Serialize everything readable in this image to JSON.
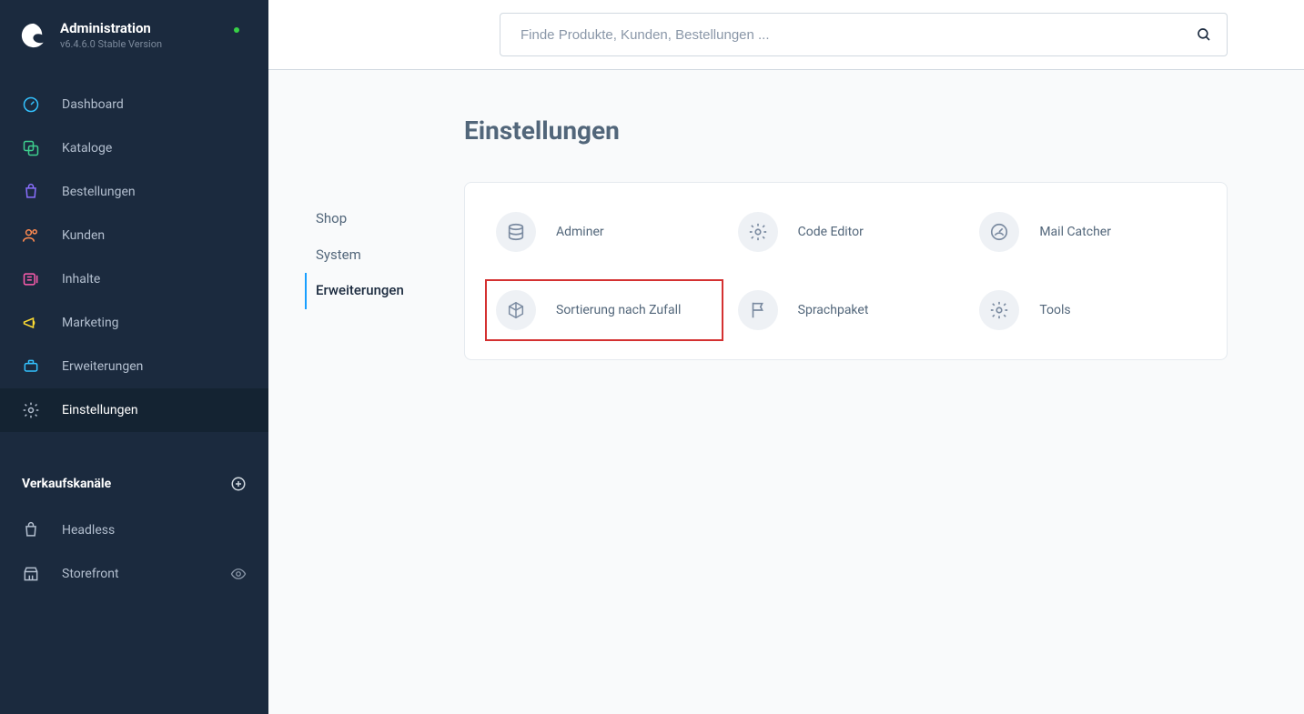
{
  "sidebar": {
    "title": "Administration",
    "version": "v6.4.6.0 Stable Version",
    "nav": [
      {
        "label": "Dashboard"
      },
      {
        "label": "Kataloge"
      },
      {
        "label": "Bestellungen"
      },
      {
        "label": "Kunden"
      },
      {
        "label": "Inhalte"
      },
      {
        "label": "Marketing"
      },
      {
        "label": "Erweiterungen"
      },
      {
        "label": "Einstellungen"
      }
    ],
    "salesChannels": {
      "title": "Verkaufskanäle",
      "items": [
        {
          "label": "Headless"
        },
        {
          "label": "Storefront"
        }
      ]
    }
  },
  "search": {
    "placeholder": "Finde Produkte, Kunden, Bestellungen ..."
  },
  "page": {
    "title": "Einstellungen",
    "tabs": [
      {
        "label": "Shop"
      },
      {
        "label": "System"
      },
      {
        "label": "Erweiterungen"
      }
    ],
    "cards": [
      {
        "label": "Adminer"
      },
      {
        "label": "Code Editor"
      },
      {
        "label": "Mail Catcher"
      },
      {
        "label": "Sortierung nach Zufall"
      },
      {
        "label": "Sprachpaket"
      },
      {
        "label": "Tools"
      }
    ]
  }
}
